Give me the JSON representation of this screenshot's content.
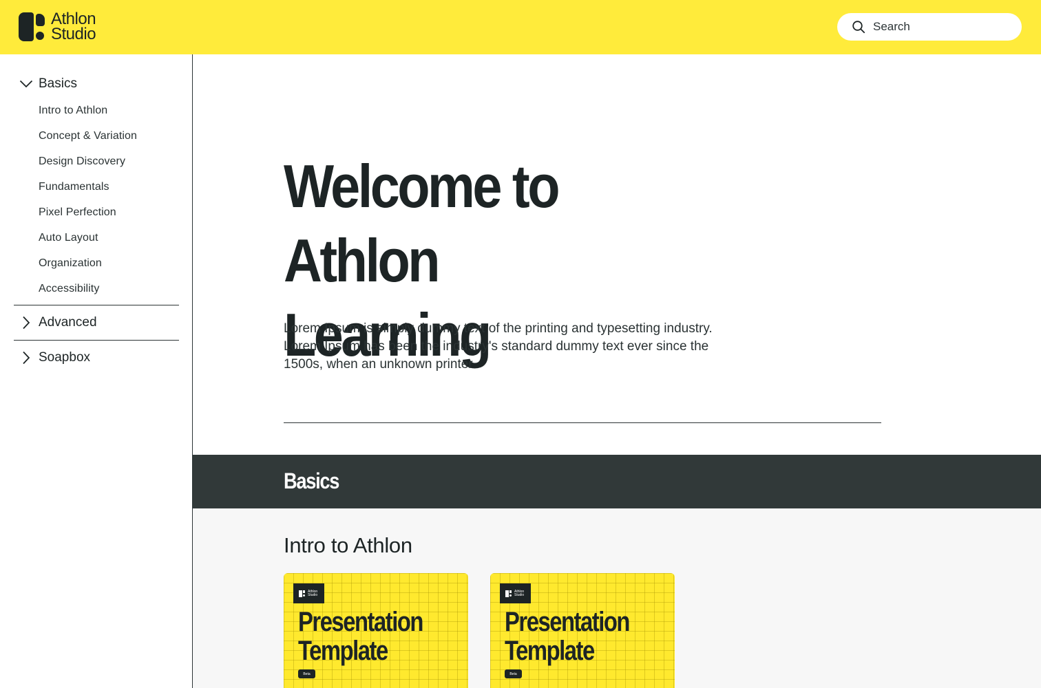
{
  "header": {
    "logo_line1": "Athlon",
    "logo_line2": "Studio",
    "search_placeholder": "Search",
    "background": "#ffeb3b"
  },
  "sidebar": {
    "groups": [
      {
        "label": "Basics",
        "expanded": true,
        "icon": "chevron-down-icon",
        "items": [
          "Intro to Athlon",
          "Concept & Variation",
          "Design Discovery",
          "Fundamentals",
          "Pixel Perfection",
          "Auto Layout",
          "Organization",
          "Accessibility"
        ]
      },
      {
        "label": "Advanced",
        "expanded": false,
        "icon": "chevron-right-icon"
      },
      {
        "label": "Soapbox",
        "expanded": false,
        "icon": "chevron-right-icon"
      }
    ]
  },
  "main": {
    "hero_title_line1": "Welcome to Athlon",
    "hero_title_line2": "Learning",
    "hero_text_line1": "Lorem Ipsum is simply dummy text of the printing and typesetting industry.",
    "hero_text_line2": "Lorem Ipsum has been the industry's standard dummy text ever since the",
    "hero_text_line3": "1500s, when an unknown printer",
    "section_title": "Basics",
    "section_band_color": "#313939",
    "subsection_title": "Intro to Athlon",
    "cards": [
      {
        "badge_line1": "Athlon",
        "badge_line2": "Studio",
        "title_line1": "Presentation",
        "title_line2": "Template",
        "tag": "Beta"
      },
      {
        "badge_line1": "Athlon",
        "badge_line2": "Studio",
        "title_line1": "Presentation",
        "title_line2": "Template",
        "tag": "Beta"
      }
    ],
    "card_color": "#ffe92e"
  }
}
